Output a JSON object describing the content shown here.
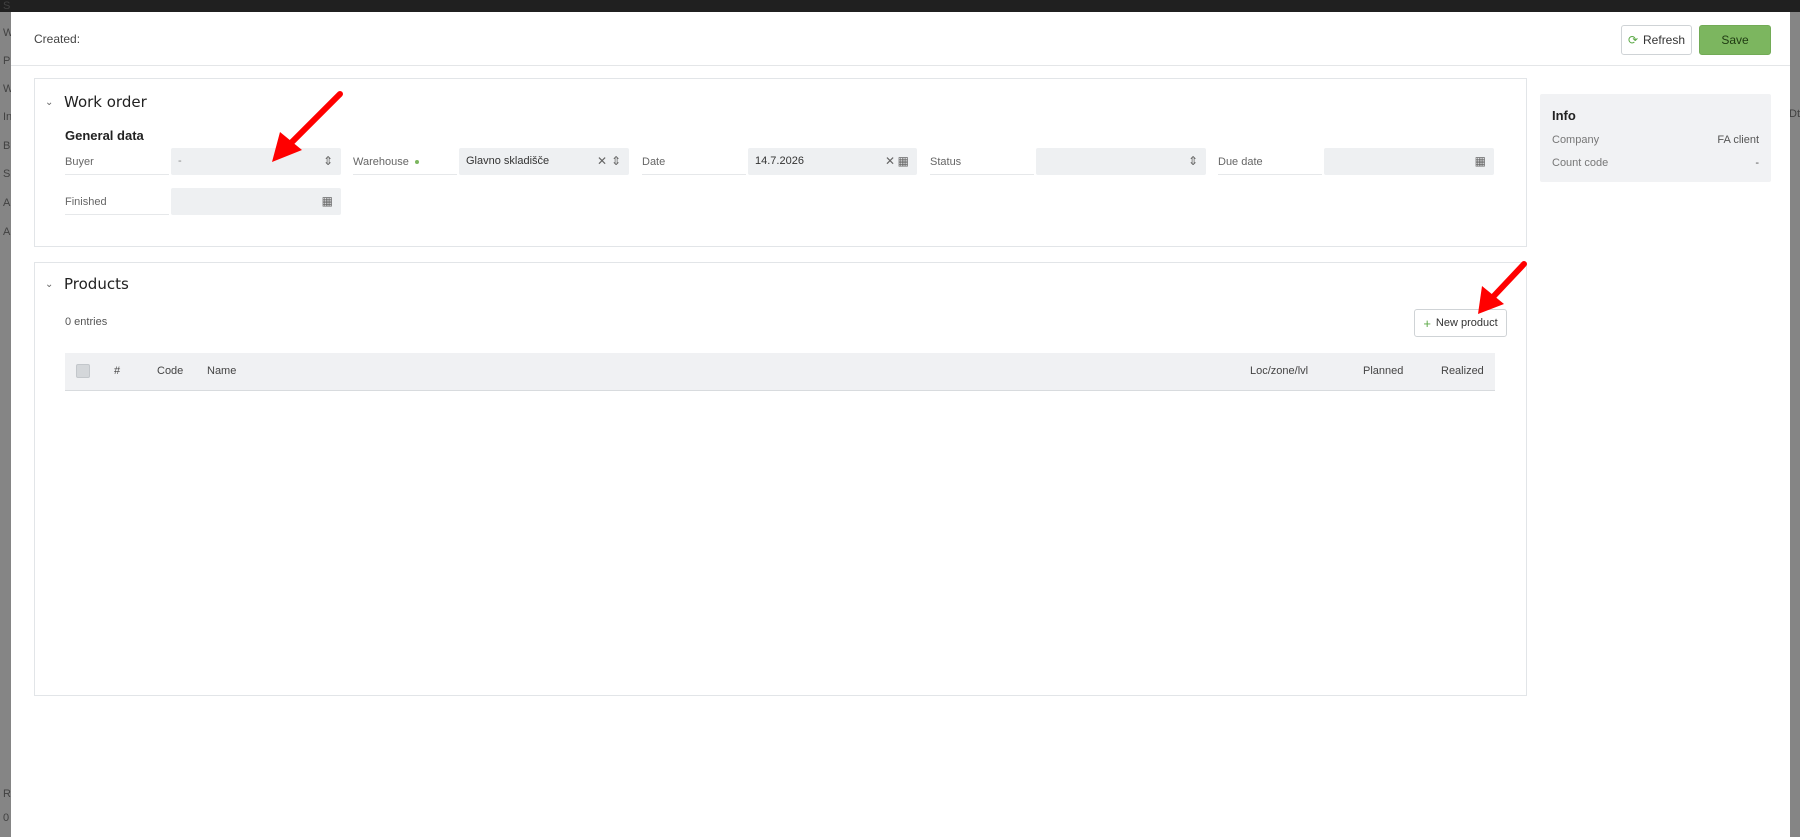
{
  "background": {
    "side_letters": [
      "S",
      "W",
      "P",
      "W",
      "In",
      "B",
      "S",
      "A",
      "A"
    ],
    "right_letter": "Dt",
    "bottom_letters": [
      "R",
      "0"
    ]
  },
  "header": {
    "created_label": "Created:",
    "refresh_label": "Refresh",
    "save_label": "Save"
  },
  "work_order": {
    "title": "Work order",
    "subsection": "General data",
    "fields": {
      "buyer": {
        "label": "Buyer",
        "value": "-"
      },
      "warehouse": {
        "label": "Warehouse",
        "value": "Glavno skladišče"
      },
      "date": {
        "label": "Date",
        "value": "14.7.2026"
      },
      "status": {
        "label": "Status",
        "value": ""
      },
      "due_date": {
        "label": "Due date",
        "value": ""
      },
      "finished": {
        "label": "Finished",
        "value": ""
      }
    }
  },
  "info": {
    "title": "Info",
    "company_label": "Company",
    "company_value": "FA client",
    "count_code_label": "Count code",
    "count_code_value": "-"
  },
  "products": {
    "title": "Products",
    "entries": "0 entries",
    "new_product_label": "New product",
    "columns": [
      "#",
      "Code",
      "Name",
      "Loc/zone/lvl",
      "Planned",
      "Realized"
    ],
    "rows": []
  },
  "colors": {
    "accent_green": "#7cb65f",
    "annotation_red": "#ff0000"
  }
}
